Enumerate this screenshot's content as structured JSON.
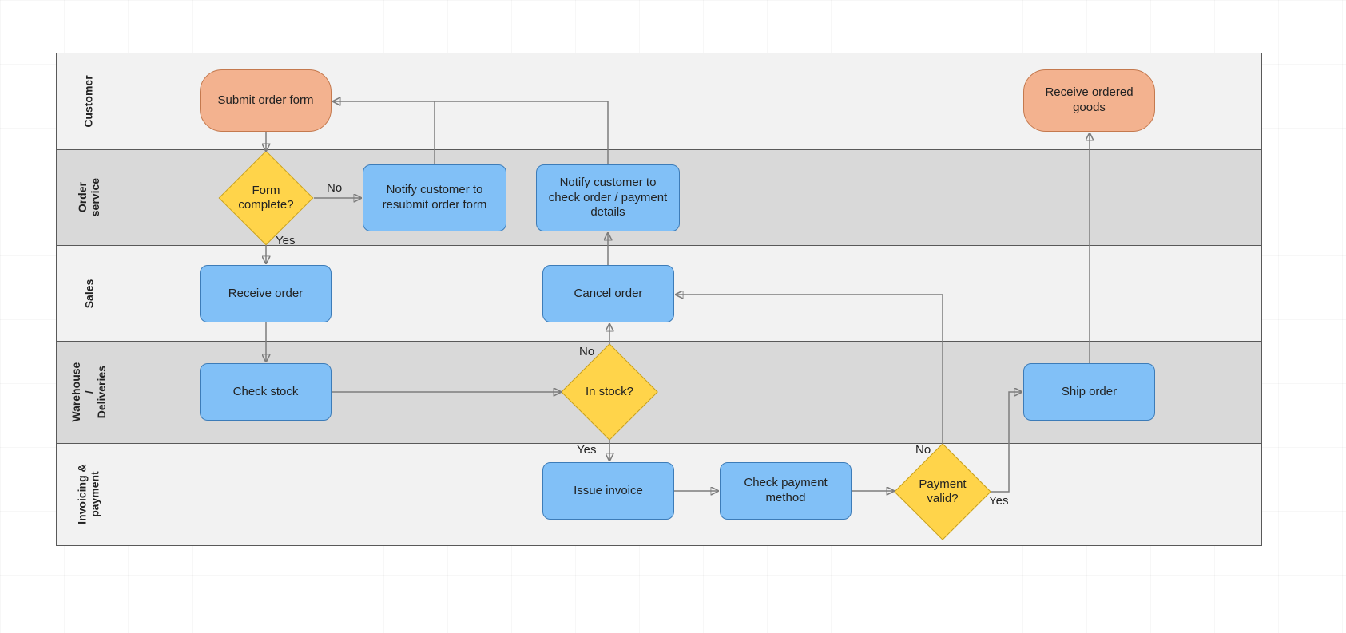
{
  "lanes": {
    "customer": "Customer",
    "order_service": "Order service",
    "sales": "Sales",
    "warehouse": "Warehouse /\nDeliveries",
    "invoicing": "Invoicing &\npayment"
  },
  "nodes": {
    "submit_order_form": "Submit order form",
    "receive_goods": "Receive ordered goods",
    "form_complete": "Form complete?",
    "notify_resubmit": "Notify customer to resubmit order form",
    "notify_check": "Notify customer to check order / payment details",
    "receive_order": "Receive order",
    "cancel_order": "Cancel order",
    "check_stock": "Check stock",
    "in_stock": "In stock?",
    "ship_order": "Ship order",
    "issue_invoice": "Issue invoice",
    "check_payment": "Check payment method",
    "payment_valid": "Payment valid?"
  },
  "edge_labels": {
    "form_complete_no": "No",
    "form_complete_yes": "Yes",
    "in_stock_no": "No",
    "in_stock_yes": "Yes",
    "payment_valid_no": "No",
    "payment_valid_yes": "Yes"
  },
  "colors": {
    "lane_light": "#f2f2f2",
    "lane_dark": "#d9d9d9",
    "process_fill": "#81c0f7",
    "process_stroke": "#3d7cb8",
    "terminator_fill": "#f3b28f",
    "terminator_stroke": "#c4794e",
    "decision_fill": "#ffd44a",
    "decision_stroke": "#c6a020",
    "connector": "#7d7d7d",
    "border": "#595959"
  }
}
